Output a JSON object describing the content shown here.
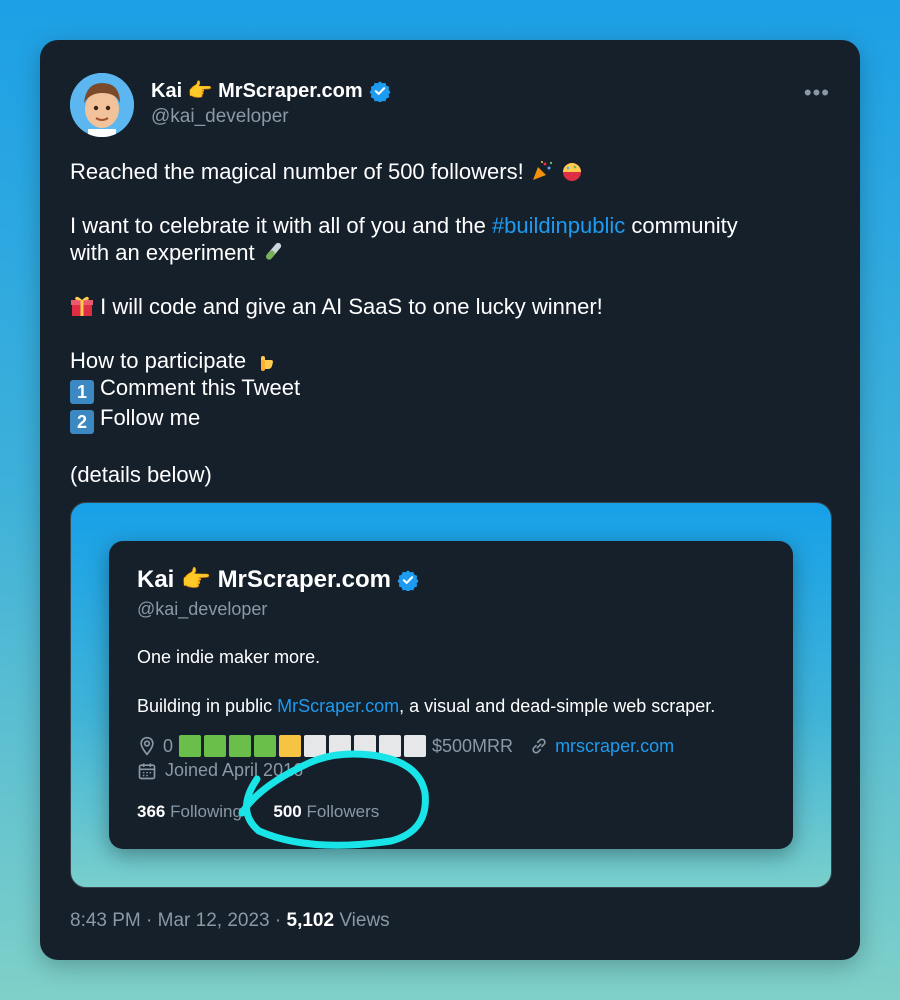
{
  "tweet": {
    "author_name": "Kai 👉 MrScraper.com",
    "author_handle": "@kai_developer",
    "more_label": "•••",
    "line1": "Reached the magical number of 500 followers!",
    "line2_pre": "I want to celebrate it with all of you and the",
    "hashtag": "#buildinpublic",
    "line2_post": "community",
    "line3": "with an experiment",
    "line4": "I will code and give an AI SaaS to one lucky winner!",
    "line5": "How to participate",
    "step1_num": "1",
    "step1": "Comment this Tweet",
    "step2_num": "2",
    "step2": "Follow me",
    "line6": "(details below)",
    "time": "8:43 PM",
    "date": "Mar 12, 2023",
    "views_count": "5,102",
    "views_label": "Views",
    "sep": "·"
  },
  "profile_card": {
    "name": "Kai 👉 MrScraper.com",
    "handle": "@kai_developer",
    "bio1": "One indie maker more.",
    "bio2_pre": "Building in public",
    "bio2_link": "MrScraper.com",
    "bio2_post": ", a visual and dead-simple web scraper.",
    "location_start": "0",
    "mrr_label": "$500MRR",
    "website": "mrscraper.com",
    "joined": "Joined April 2016",
    "following_count": "366",
    "following_label": "Following",
    "followers_count": "500",
    "followers_label": "Followers",
    "progress_colors": [
      "#6abf4b",
      "#6abf4b",
      "#6abf4b",
      "#6abf4b",
      "#f6c343",
      "#e6e7e8",
      "#e6e7e8",
      "#e6e7e8",
      "#e6e7e8",
      "#e6e7e8"
    ]
  },
  "colors": {
    "link": "#1d9bf0",
    "card_bg": "#15202b",
    "muted": "#8b98a5",
    "annotation": "#19e4e8"
  }
}
